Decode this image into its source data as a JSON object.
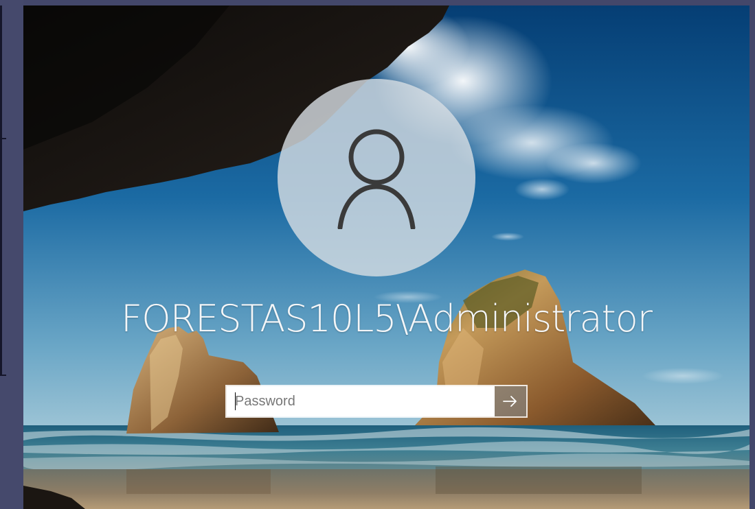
{
  "login": {
    "username": "FORESTAS10L5\\Administrator",
    "password_placeholder": "Password",
    "password_value": ""
  },
  "icons": {
    "avatar": "user-icon",
    "submit": "arrow-right-icon"
  },
  "colors": {
    "frame": "#43476a",
    "avatar_circle": "#d8dee4",
    "username_text": "#f4f6f8",
    "input_background": "#ffffff"
  }
}
